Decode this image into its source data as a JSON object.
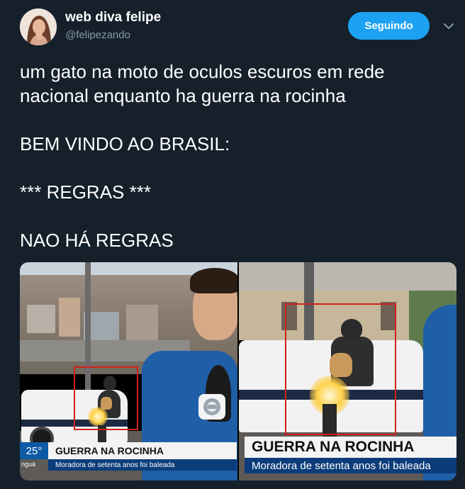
{
  "author": {
    "display_name": "web diva felipe",
    "handle": "@felipezando"
  },
  "follow_button": {
    "label": "Seguindo"
  },
  "tweet": {
    "lines": [
      "um gato na moto de oculos escuros em rede",
      "nacional enquanto ha guerra na rocinha",
      "",
      "BEM VINDO AO BRASIL:",
      "",
      "*** REGRAS ***",
      "",
      "NAO HÁ REGRAS"
    ]
  },
  "media": {
    "left_frame": {
      "temperature": "25°",
      "city": "nguá",
      "headline": "GUERRA NA ROCINHA",
      "subheadline": "Moradora de setenta anos foi baleada"
    },
    "right_frame": {
      "headline": "GUERRA NA ROCINHA",
      "subheadline": "Moradora de setenta anos foi baleada"
    }
  },
  "colors": {
    "background": "#15202b",
    "accent": "#1da1f2",
    "secondary_text": "#8899a6",
    "highlight_box": "#d0211c"
  },
  "icons": {
    "caret": "chevron-down-icon"
  }
}
